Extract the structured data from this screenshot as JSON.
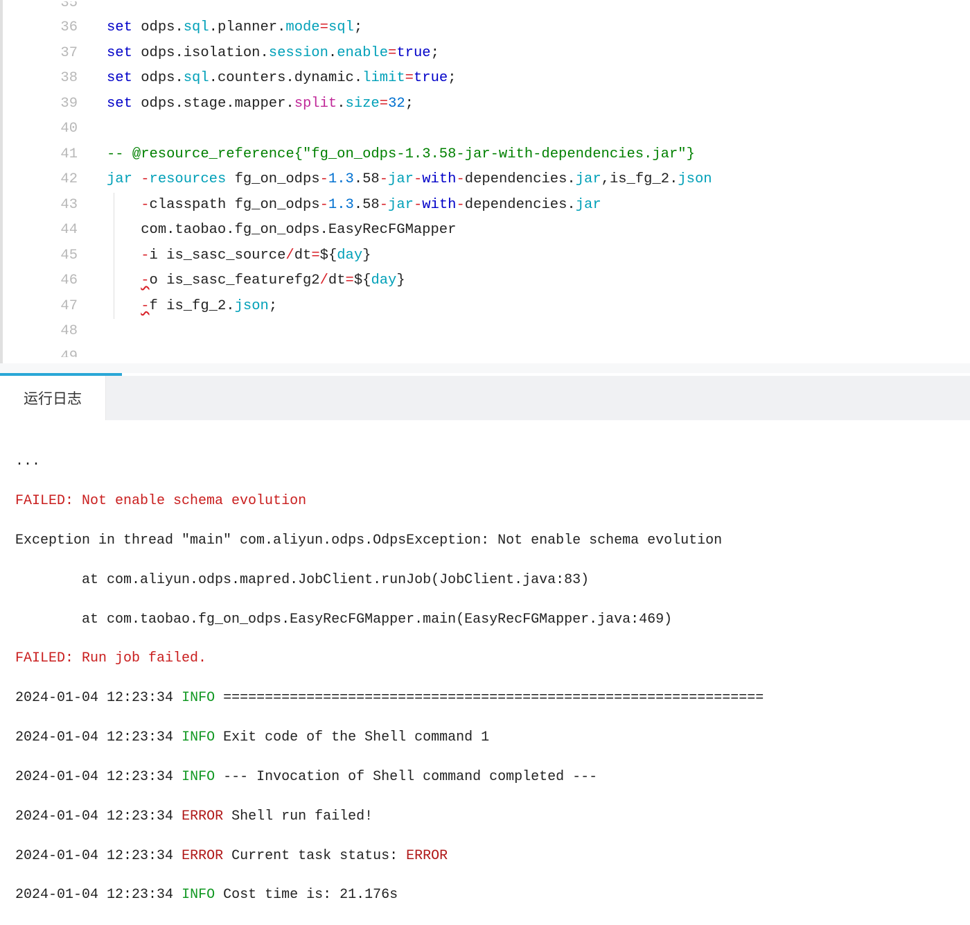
{
  "editor": {
    "lines": [
      {
        "n": 36
      },
      {
        "n": 37
      },
      {
        "n": 38
      },
      {
        "n": 39
      },
      {
        "n": 40
      },
      {
        "n": 41
      },
      {
        "n": 42
      },
      {
        "n": 43
      },
      {
        "n": 44
      },
      {
        "n": 45
      },
      {
        "n": 46
      },
      {
        "n": 47
      },
      {
        "n": 48
      }
    ],
    "tokens": {
      "set": "set",
      "odps": "odps",
      "sql": "sql",
      "planner": "planner",
      "mode": "mode",
      "isolation": "isolation",
      "session": "session",
      "enable": "enable",
      "true": "true",
      "counters": "counters",
      "dynamic": "dynamic",
      "limit": "limit",
      "stage": "stage",
      "mapper": "mapper",
      "split": "split",
      "size": "size",
      "n32": "32",
      "comment_prefix": "-- ",
      "comment_at": "@resource_reference",
      "comment_brace_open": "{",
      "comment_str": "\"fg_on_odps-1.3.58-jar-with-dependencies.jar\"",
      "comment_brace_close": "}",
      "jar": "jar",
      "dash": "-",
      "resources": "resources",
      "fg_on_odps": "fg_on_odps",
      "v1": "1.3",
      "v2": ".58",
      "jar_word": "jar",
      "with": "with",
      "dependencies": "dependencies",
      "dot_jar": ".jar",
      "comma": ",",
      "is_fg_2": "is_fg_2",
      "json": "json",
      "classpath": "classpath",
      "com": "com.taobao.fg_on_odps.EasyRecFGMapper",
      "dash_i": "i",
      "is_sasc_source": "is_sasc_source",
      "slash": "/",
      "dt": "dt",
      "eq": "=",
      "dollar": "$",
      "brace_open": "{",
      "day": "day",
      "brace_close": "}",
      "dash_o": "o",
      "is_sasc_featurefg2": "is_sasc_featurefg2",
      "dash_f": "f",
      "semi": ";",
      "dot": "."
    }
  },
  "panel": {
    "tab_label": "运行日志",
    "log": {
      "ellipsis": "...",
      "failed1": "FAILED: Not enable schema evolution",
      "exc": "Exception in thread \"main\" com.aliyun.odps.OdpsException: Not enable schema evolution",
      "at1": "        at com.aliyun.odps.mapred.JobClient.runJob(JobClient.java:83)",
      "at2": "        at com.taobao.fg_on_odps.EasyRecFGMapper.main(EasyRecFGMapper.java:469)",
      "failed2": "FAILED: Run job failed.",
      "ts": "2024-01-04 12:23:34",
      "info": "INFO",
      "error": "ERROR",
      "sep": " =================================================================",
      "exit_code": " Exit code of the Shell command 1",
      "invocation": " --- Invocation of Shell command completed ---",
      "shell_fail": " Shell run failed!",
      "task_status_prefix": " Current task status: ",
      "task_status_value": "ERROR",
      "cost_time": " Cost time is: 21.176s"
    }
  }
}
